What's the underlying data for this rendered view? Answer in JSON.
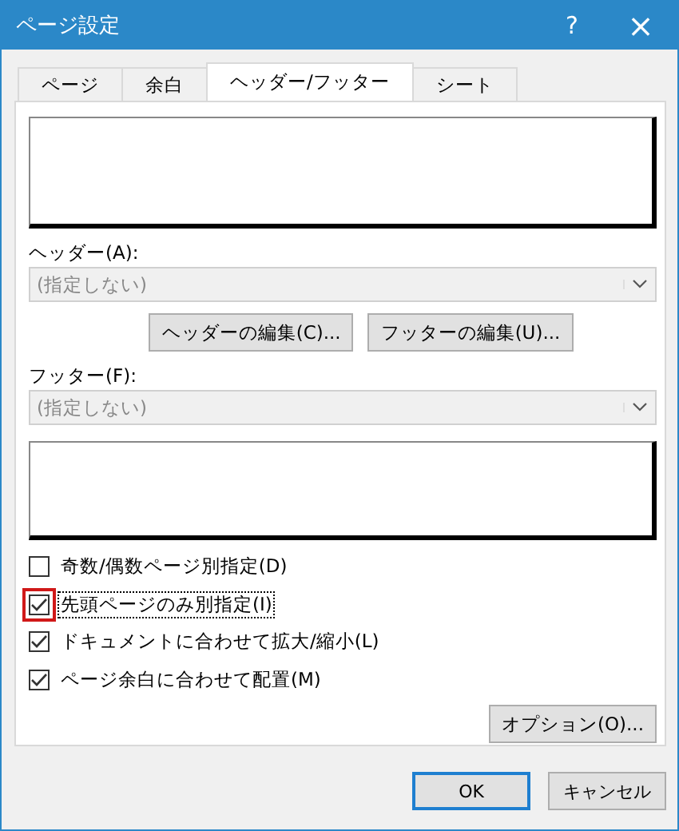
{
  "window": {
    "title": "ページ設定",
    "help": "?",
    "close": "×"
  },
  "tabs": [
    {
      "label": "ページ",
      "selected": false
    },
    {
      "label": "余白",
      "selected": false
    },
    {
      "label": "ヘッダー/フッター",
      "selected": true
    },
    {
      "label": "シート",
      "selected": false
    }
  ],
  "header": {
    "label": "ヘッダー(A):",
    "value": "(指定しない)",
    "disabled": true
  },
  "edit_buttons": [
    "ヘッダーの編集(C)...",
    "フッターの編集(U)..."
  ],
  "footer": {
    "label": "フッター(F):",
    "value": "(指定しない)",
    "disabled": true
  },
  "options": [
    {
      "label": "奇数/偶数ページ別指定(D)",
      "checked": false,
      "focused": false,
      "highlighted": false
    },
    {
      "label": "先頭ページのみ別指定(I)",
      "checked": true,
      "focused": true,
      "highlighted": true
    },
    {
      "label": "ドキュメントに合わせて拡大/縮小(L)",
      "checked": true,
      "focused": false,
      "highlighted": false
    },
    {
      "label": "ページ余白に合わせて配置(M)",
      "checked": true,
      "focused": false,
      "highlighted": false
    }
  ],
  "options_button": "オプション(O)...",
  "buttons": [
    {
      "label": "OK",
      "default": true
    },
    {
      "label": "キャンセル",
      "default": false
    }
  ]
}
